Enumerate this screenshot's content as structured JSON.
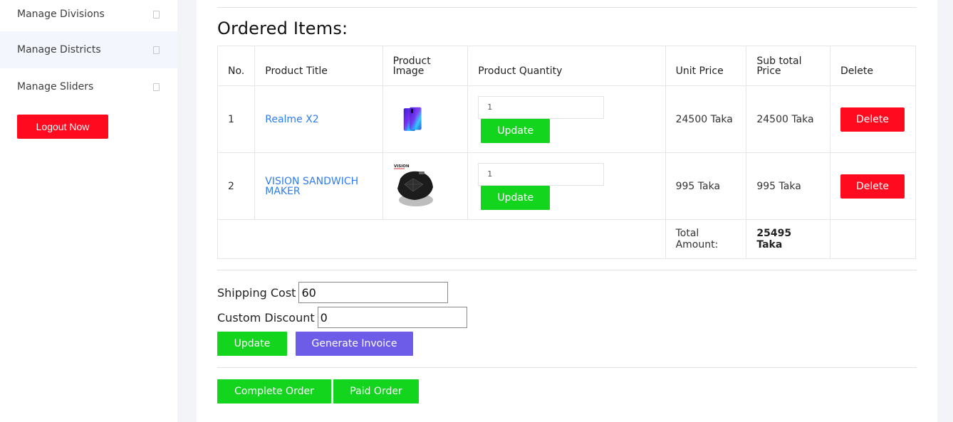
{
  "sidebar": {
    "items": [
      {
        "label": "Manage Divisions"
      },
      {
        "label": "Manage Districts"
      },
      {
        "label": "Manage Sliders"
      }
    ],
    "logout_label": "Logout Now"
  },
  "main": {
    "heading": "Ordered Items:",
    "table": {
      "headers": [
        "No.",
        "Product Title",
        "Product Image",
        "Product Quantity",
        "Unit Price",
        "Sub total Price",
        "Delete"
      ],
      "rows": [
        {
          "no": "1",
          "title": "Realme X2",
          "quantity": "1",
          "update_label": "Update",
          "unit_price": "24500 Taka",
          "subtotal": "24500 Taka",
          "delete_label": "Delete"
        },
        {
          "no": "2",
          "title": "VISION SANDWICH MAKER",
          "quantity": "1",
          "update_label": "Update",
          "unit_price": "995 Taka",
          "subtotal": "995 Taka",
          "delete_label": "Delete",
          "image_brand_text": "VISION"
        }
      ],
      "total_label": "Total Amount:",
      "total_value": "25495 Taka"
    },
    "shipping": {
      "label": "Shipping Cost",
      "value": "60"
    },
    "discount": {
      "label": "Custom Discount",
      "value": "0"
    },
    "update_label": "Update",
    "generate_invoice_label": "Generate Invoice",
    "complete_order_label": "Complete Order",
    "paid_order_label": "Paid Order"
  },
  "colors": {
    "green": "#13d51e",
    "red": "#ff0a1e",
    "purple": "#6c5ce7",
    "link": "#2e7cf6"
  }
}
